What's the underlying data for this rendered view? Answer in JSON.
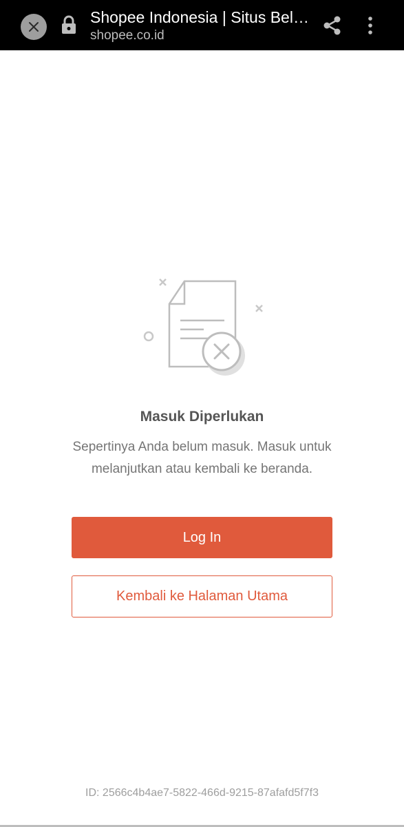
{
  "browser_bar": {
    "title": "Shopee Indonesia | Situs Belanja Online Terlengkap",
    "url": "shopee.co.id"
  },
  "main": {
    "heading": "Masuk Diperlukan",
    "message": "Sepertinya Anda belum masuk. Masuk untuk melanjutkan atau kembali ke beranda.",
    "login_label": "Log In",
    "home_label": "Kembali ke Halaman Utama",
    "session_id": "ID: 2566c4b4ae7-5822-466d-9215-87afafd5f7f3"
  },
  "colors": {
    "brand": "#e05a3c",
    "topbar": "#000000"
  },
  "icons": [
    "close-icon",
    "lock-icon",
    "share-icon",
    "more-vert-icon",
    "document-error-icon"
  ]
}
